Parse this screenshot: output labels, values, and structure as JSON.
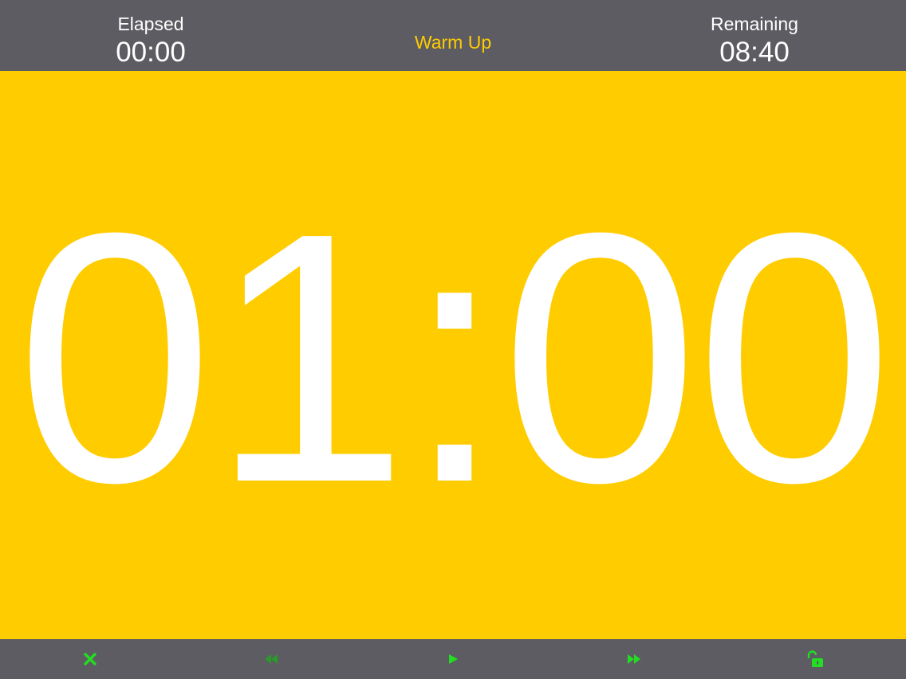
{
  "header": {
    "elapsed_label": "Elapsed",
    "elapsed_value": "00:00",
    "phase": "Warm Up",
    "remaining_label": "Remaining",
    "remaining_value": "08:40"
  },
  "timer": {
    "display": "01:00"
  },
  "toolbar": {
    "buttons": [
      {
        "icon": "close-icon",
        "enabled": true
      },
      {
        "icon": "rewind-icon",
        "enabled": false
      },
      {
        "icon": "play-icon",
        "enabled": true
      },
      {
        "icon": "fast-forward-icon",
        "enabled": true
      },
      {
        "icon": "unlock-icon",
        "enabled": true
      }
    ]
  },
  "colors": {
    "background": "#ffcc00",
    "bar": "#5d5c62",
    "accent_green": "#22dd22",
    "disabled_green": "#2a9a2a",
    "phase_text": "#ffcc00",
    "text": "#ffffff"
  }
}
